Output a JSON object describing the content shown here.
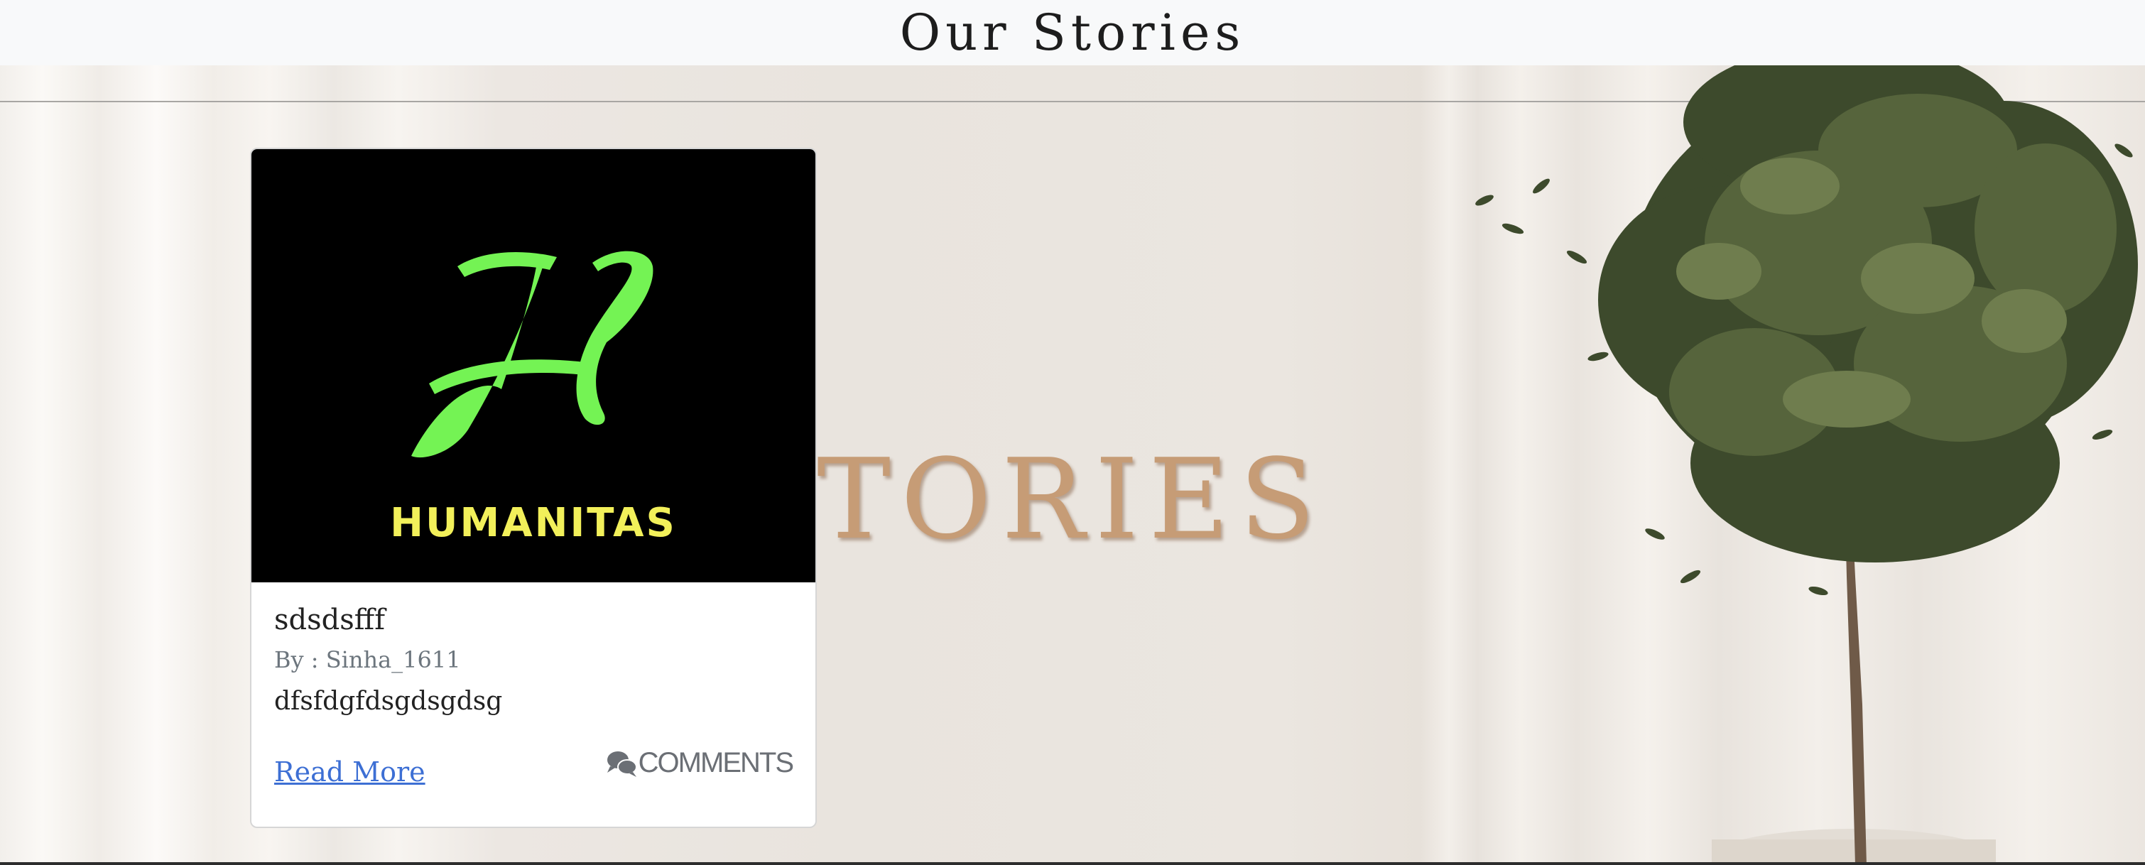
{
  "header": {
    "title": "Our Stories"
  },
  "hero": {
    "wall_letters": "TORIES"
  },
  "story_card": {
    "logo_text": "HUMANITAS",
    "logo_letter": "H",
    "title": "sdsdsfff",
    "author": "By : Sinha_1611",
    "excerpt": "dfsfdgfdsgdsgdsg",
    "read_more_label": "Read More",
    "comments_label": "COMMENTS",
    "comments_icon": "chat-bubbles-icon",
    "logo_green": "#74f354",
    "logo_yellow": "#f2f05a",
    "link_color": "#3d6fd4"
  }
}
